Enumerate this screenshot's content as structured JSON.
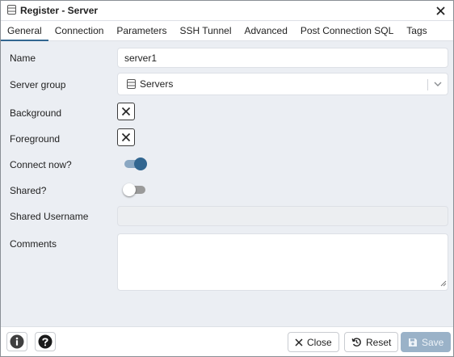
{
  "dialog": {
    "title": "Register - Server"
  },
  "tabs": [
    {
      "label": "General",
      "active": true
    },
    {
      "label": "Connection"
    },
    {
      "label": "Parameters"
    },
    {
      "label": "SSH Tunnel"
    },
    {
      "label": "Advanced"
    },
    {
      "label": "Post Connection SQL"
    },
    {
      "label": "Tags"
    }
  ],
  "form": {
    "name": {
      "label": "Name",
      "value": "server1"
    },
    "server_group": {
      "label": "Server group",
      "value": "Servers"
    },
    "background": {
      "label": "Background"
    },
    "foreground": {
      "label": "Foreground"
    },
    "connect_now": {
      "label": "Connect now?",
      "checked": true
    },
    "shared": {
      "label": "Shared?",
      "checked": false
    },
    "shared_username": {
      "label": "Shared Username",
      "value": ""
    },
    "comments": {
      "label": "Comments",
      "value": ""
    }
  },
  "footer": {
    "info_icon": "info-icon",
    "help_icon": "help-icon",
    "close_label": "Close",
    "reset_label": "Reset",
    "save_label": "Save"
  },
  "colors": {
    "accent": "#326690",
    "save_disabled": "#9ab2c8",
    "background": "#ebeef3"
  }
}
